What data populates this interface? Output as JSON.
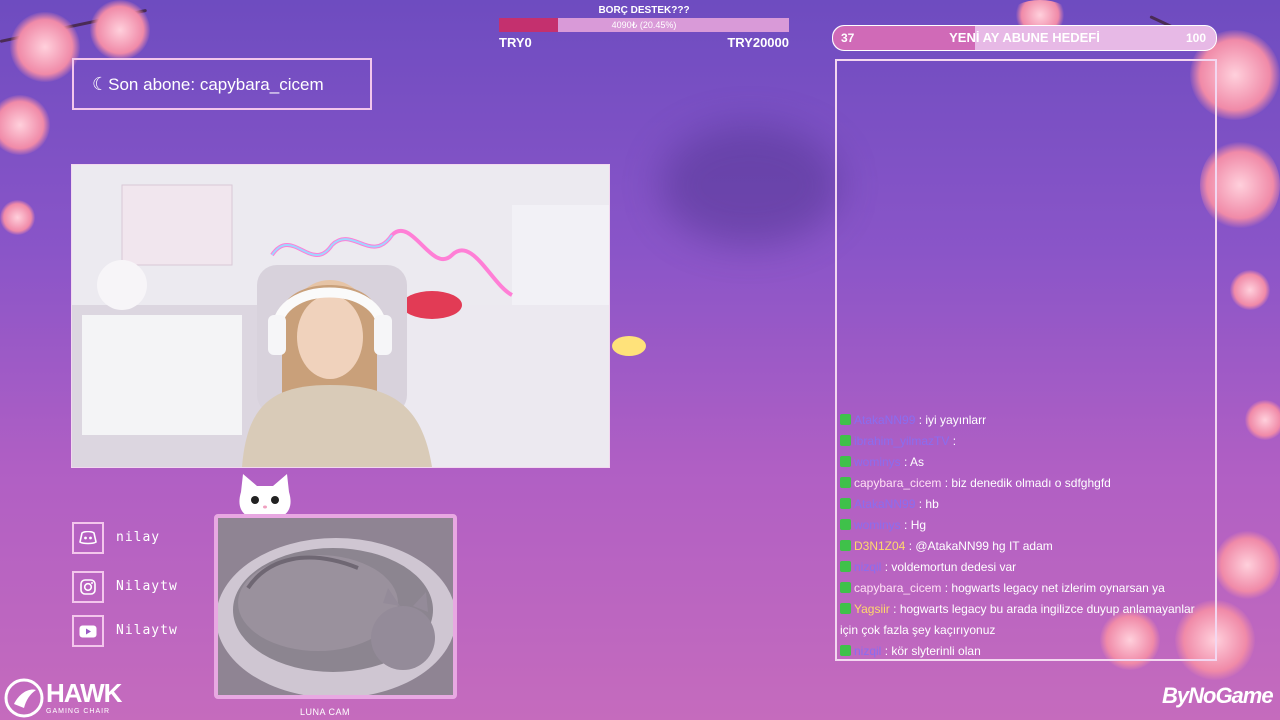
{
  "donation": {
    "title": "BORÇ DESTEK???",
    "progress_text": "4090₺ (20.45%)",
    "progress_fraction": 0.2045,
    "min_label": "TRY0",
    "max_label": "TRY20000",
    "fill_color": "#c4306e"
  },
  "sub_goal": {
    "current": "37",
    "label": "YENİ AY ABUNE HEDEFİ",
    "target": "100",
    "progress_fraction": 0.37
  },
  "last_sub": {
    "text": "Son abone: capybara_cicem",
    "icon": "moon-icon"
  },
  "socials": [
    {
      "icon": "discord-icon",
      "handle": "nilay"
    },
    {
      "icon": "instagram-icon",
      "handle": "Nilaytw"
    },
    {
      "icon": "youtube-icon",
      "handle": "Nilaytw"
    }
  ],
  "cat_cam_label": "LUNA CAM",
  "chat": [
    {
      "user": "AtakaNN99",
      "user_color": "#8a6df0",
      "text": "iyi yayınlarr"
    },
    {
      "user": "ibrahim_yilmazTV",
      "user_color": "#8a6df0",
      "text": ""
    },
    {
      "user": "wominys",
      "user_color": "#8a6df0",
      "text": "As"
    },
    {
      "user": "capybara_cicem",
      "user_color": "#ffe0f4",
      "text": "biz denedik olmadı o sdfghgfd"
    },
    {
      "user": "AtakaNN99",
      "user_color": "#8a6df0",
      "text": "hb"
    },
    {
      "user": "wominys",
      "user_color": "#8a6df0",
      "text": "Hg"
    },
    {
      "user": "D3N1Z04",
      "user_color": "#ffd86b",
      "text": "@AtakaNN99 hg IT adam"
    },
    {
      "user": "nizqil",
      "user_color": "#8a6df0",
      "text": "voldemortun dedesi var"
    },
    {
      "user": "capybara_cicem",
      "user_color": "#ffe0f4",
      "text": "hogwarts legacy net izlerim oynarsan ya"
    },
    {
      "user": "Yagsiir",
      "user_color": "#ffd86b",
      "text": "hogwarts legacy bu arada ingilizce duyup anlamayanlar için çok fazla şey kaçırıyonuz"
    },
    {
      "user": "nizqil",
      "user_color": "#8a6df0",
      "text": "kör slyterinli olan"
    }
  ],
  "sponsor": {
    "brand": "HAWK",
    "tagline": "GAMING CHAIR"
  },
  "watermark": "ByNoGame"
}
